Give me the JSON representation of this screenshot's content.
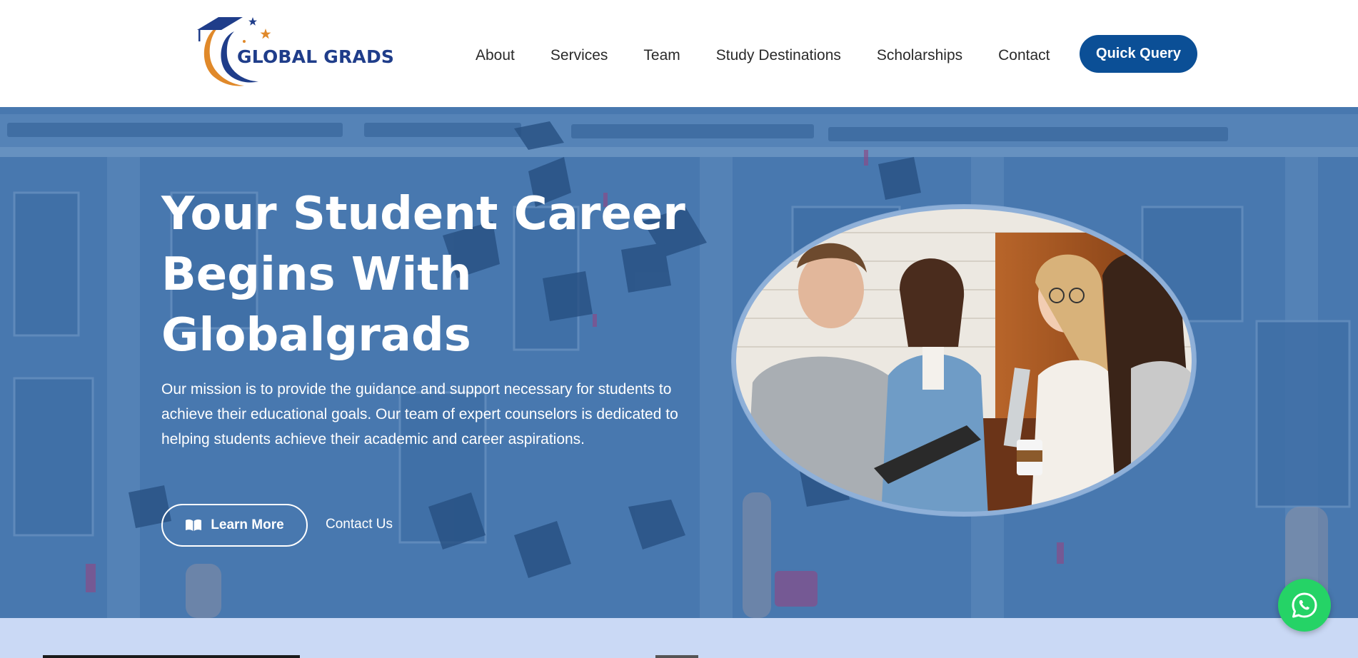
{
  "brand": {
    "name": "GLOBAL GRADS",
    "logo_icon": "graduation-cap-crescent-logo",
    "primary_color": "#1f3d8a",
    "accent_color": "#e0892a"
  },
  "nav": {
    "items": [
      {
        "label": "About"
      },
      {
        "label": "Services"
      },
      {
        "label": "Team"
      },
      {
        "label": "Study Destinations"
      },
      {
        "label": "Scholarships"
      },
      {
        "label": "Contact"
      }
    ],
    "quick_query_label": "Quick Query",
    "quick_query_color": "#0b4f96"
  },
  "hero": {
    "title_lines": [
      "Your Student Career",
      "Begins With",
      "Globalgrads"
    ],
    "description": "Our mission is to provide the guidance and support necessary for students to achieve their educational goals. Our team of expert counselors is dedicated to helping students achieve their academic and career aspirations.",
    "learn_more_label": "Learn More",
    "learn_more_icon": "open-book-icon",
    "contact_label": "Contact Us",
    "overlay_color": "#3f6fa8"
  },
  "floating": {
    "whatsapp_icon": "whatsapp-icon",
    "whatsapp_color": "#25d366"
  }
}
